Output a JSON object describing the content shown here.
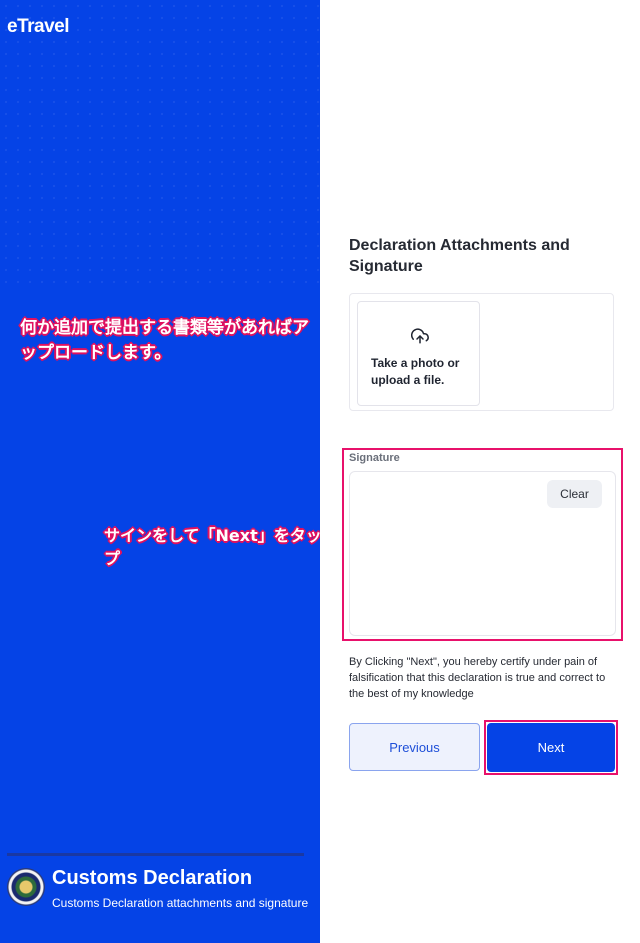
{
  "brand": {
    "logo": "eTravel"
  },
  "annotations": {
    "upload_note": "何か追加で提出する書類等があればアップロードします。",
    "sign_note": "サインをして「Next」をタップ"
  },
  "footer": {
    "title": "Customs Declaration",
    "subtitle": "Customs Declaration attachments and signature"
  },
  "form": {
    "title": "Declaration Attachments and Signature",
    "upload_text": "Take a photo or upload a file.",
    "signature_label": "Signature",
    "clear_label": "Clear",
    "certification": "By Clicking \"Next\", you hereby certify under pain of falsification that this declaration is true and correct to the best of my knowledge",
    "previous_label": "Previous",
    "next_label": "Next"
  },
  "colors": {
    "primary": "#0543e6",
    "highlight": "#e8116b"
  },
  "icons": [
    "upload-cloud-icon",
    "seal-icon"
  ]
}
